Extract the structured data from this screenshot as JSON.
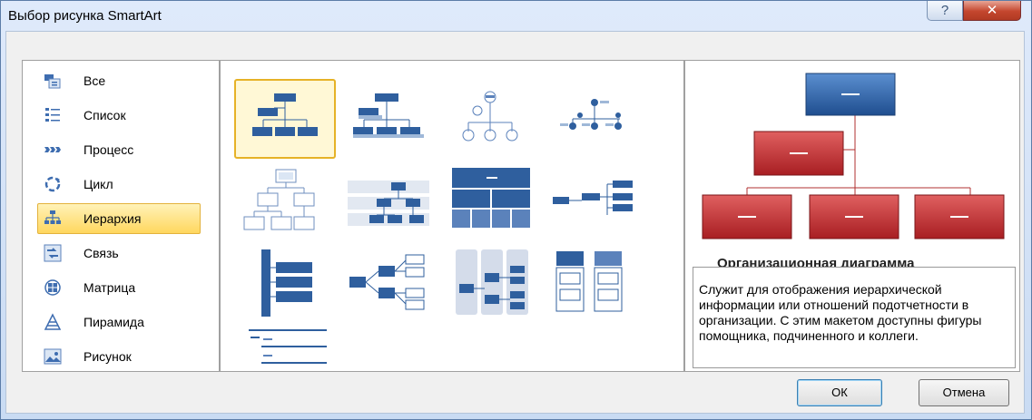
{
  "window": {
    "title": "Выбор рисунка SmartArt",
    "help_icon": "help-icon",
    "close_icon": "close-icon"
  },
  "categories": [
    {
      "label": "Все",
      "icon": "all-icon"
    },
    {
      "label": "Список",
      "icon": "list-icon"
    },
    {
      "label": "Процесс",
      "icon": "process-icon"
    },
    {
      "label": "Цикл",
      "icon": "cycle-icon"
    },
    {
      "label": "Иерархия",
      "icon": "hierarchy-icon",
      "selected": true
    },
    {
      "label": "Связь",
      "icon": "relationship-icon"
    },
    {
      "label": "Матрица",
      "icon": "matrix-icon"
    },
    {
      "label": "Пирамида",
      "icon": "pyramid-icon"
    },
    {
      "label": "Рисунок",
      "icon": "picture-icon"
    }
  ],
  "preview": {
    "title": "Организационная диаграмма",
    "description": "Служит для отображения иерархической информации или отношений подотчетности в организации. С этим макетом доступны фигуры помощника, подчиненного и коллеги."
  },
  "buttons": {
    "ok": "ОК",
    "cancel": "Отмена"
  },
  "colors": {
    "accent_blue": "#2f5f9e",
    "preview_red": "#c0282b",
    "selection": "#ffd75e"
  }
}
